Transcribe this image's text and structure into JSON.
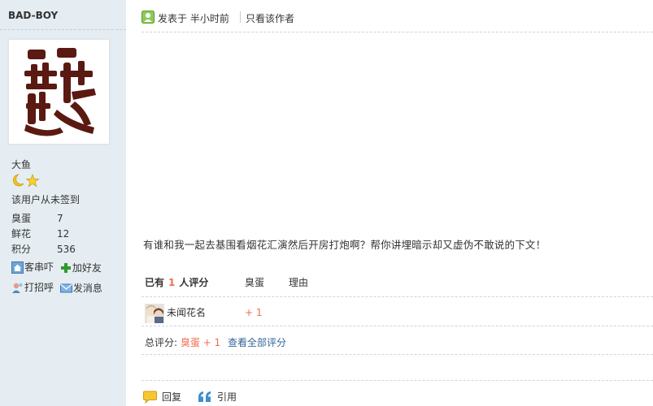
{
  "profile": {
    "username": "BAD-BOY",
    "nickname": "大鱼",
    "signin_status": "该用户从未签到",
    "stats": [
      {
        "label": "臭蛋",
        "value": "7"
      },
      {
        "label": "鲜花",
        "value": "12"
      },
      {
        "label": "积分",
        "value": "536"
      }
    ],
    "actions": {
      "visit": "客串吓",
      "add_friend": "加好友",
      "greet": "打招呼",
      "message": "发消息"
    }
  },
  "post": {
    "posted_label": "发表于",
    "posted_time": "半小时前",
    "only_author": "只看该作者",
    "content": "有谁和我一起去基围看烟花汇演然后开房打炮啊？帮你讲埋暗示却又虚伪不敢说的下文！"
  },
  "rating": {
    "prefix": "已有",
    "count": "1",
    "suffix": "人评分",
    "col_item": "臭蛋",
    "col_reason": "理由",
    "entries": [
      {
        "user": "未闻花名",
        "points": "+ 1"
      }
    ],
    "total_label": "总评分:",
    "total_value": "臭蛋 + 1",
    "view_all": "查看全部评分"
  },
  "footer": {
    "reply": "回复",
    "quote": "引用"
  },
  "colors": {
    "sidebar_bg": "#e5edf2",
    "accent_orange": "#f26c4f",
    "link_blue": "#336699"
  }
}
